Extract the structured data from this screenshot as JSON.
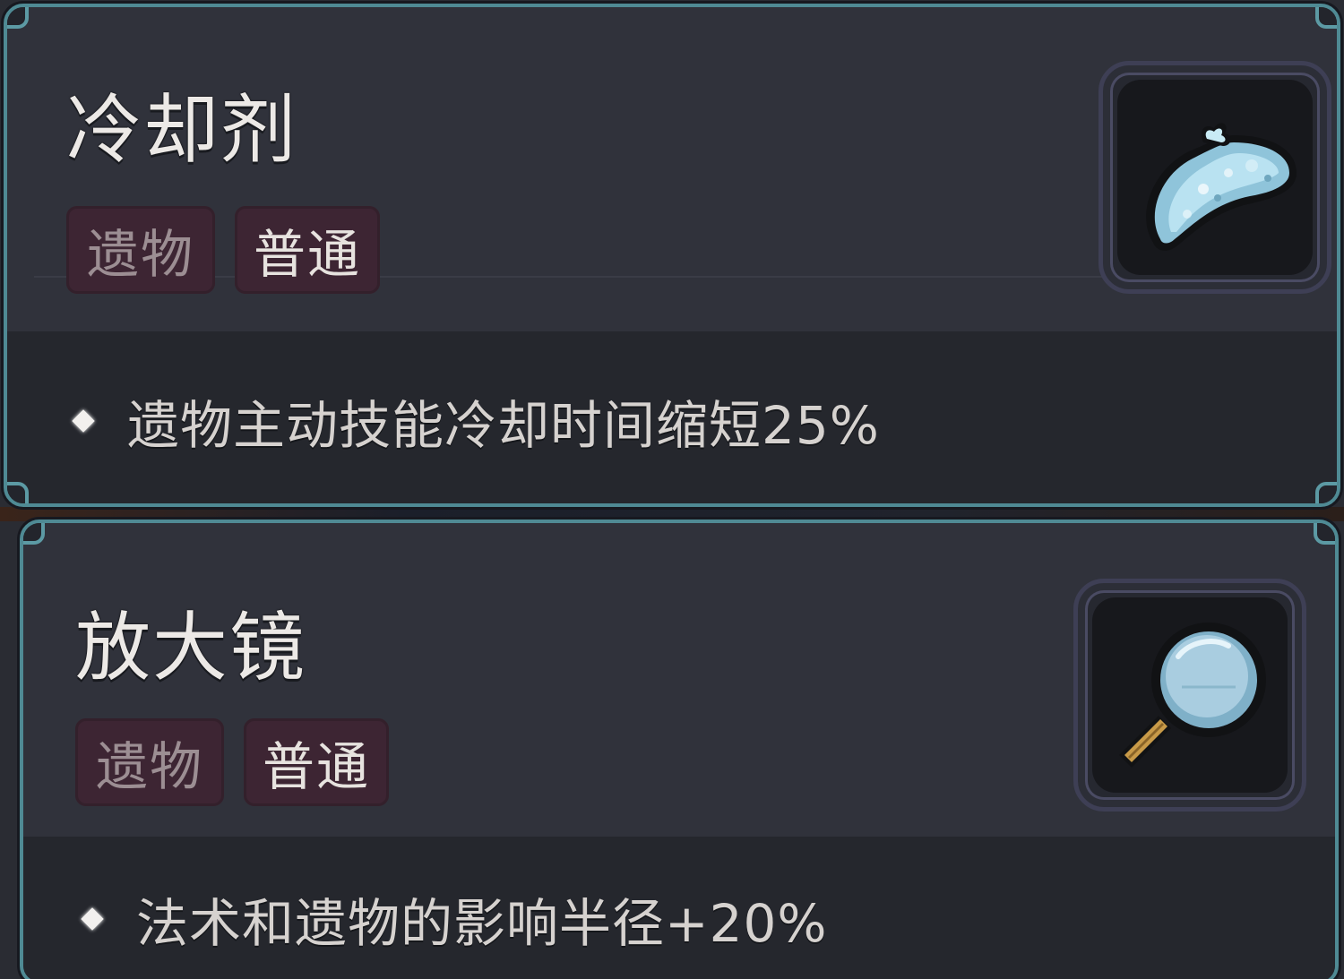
{
  "cards": [
    {
      "name": "冷却剂",
      "tags": [
        "遗物",
        "普通"
      ],
      "icon": "ice-pack-icon",
      "effects": [
        "遗物主动技能冷却时间缩短25%"
      ]
    },
    {
      "name": "放大镜",
      "tags": [
        "遗物",
        "普通"
      ],
      "icon": "magnifying-glass-icon",
      "effects": [
        "法术和遗物的影响半径+20%"
      ]
    }
  ],
  "colors": {
    "frame_border": "#4f8a94",
    "card_bg": "#30323b",
    "desc_bg": "#25272d",
    "tag_bg": "#3d2533",
    "title_text": "#ece9e6"
  }
}
